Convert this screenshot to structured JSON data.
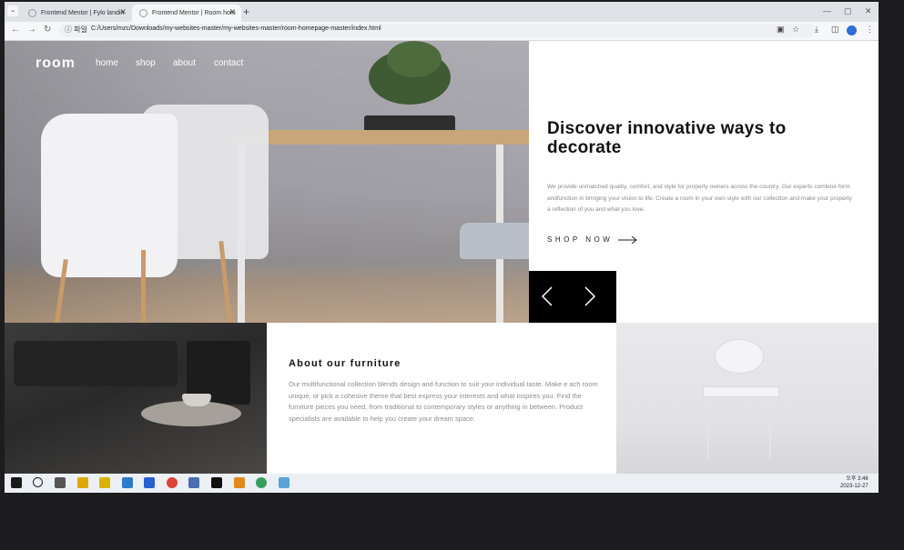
{
  "browser": {
    "tabs": [
      {
        "title": "Frontend Mentor | Fylo landin",
        "close": "✕"
      },
      {
        "title": "Frontend Mentor | Room hom",
        "close": "✕"
      }
    ],
    "new_tab": "+",
    "tab_list": "⌄",
    "window_controls": [
      "—",
      "▢",
      "✕"
    ],
    "site_info_label": "ⓘ 파일",
    "url": "C:/Users/mzc/Downloads/my-websites-master/my-websites-master/room-homepage-master/index.html",
    "icons": [
      "back-icon",
      "forward-icon",
      "reload-icon",
      "translate-icon",
      "star-icon",
      "download-icon",
      "sidepanel-icon",
      "profile-icon",
      "menu-icon"
    ]
  },
  "site": {
    "logo": "room",
    "nav": [
      "home",
      "shop",
      "about",
      "contact"
    ],
    "hero": {
      "title": "Discover innovative ways to decorate",
      "body": "We provide unmatched quality, comfort, and style for property owners across the country. Our experts combine form andfunction in bringing your vision to life. Create a room in your own style with our collection and make your property a reflection of you and what you love.",
      "cta": "SHOP NOW"
    },
    "slider": {
      "prev": "prev-icon",
      "next": "next-icon"
    },
    "about": {
      "title": "About our furniture",
      "body": "Our multifunctional collection blends design and function to suit your individual taste. Make e ach room unique, or pick a cohesive theme that best express your interests and what inspires you. Find the furniture pieces you need, from traditional to contemporary styles or anything in between. Product specialists are available to help you create your dream space."
    }
  },
  "taskbar": {
    "apps": [
      "windows-start-icon",
      "search-icon",
      "task-view-icon",
      "file-explorer-icon",
      "calendar-app-icon",
      "mail-icon",
      "zoom-icon",
      "chrome-icon",
      "3d-app-icon",
      "terminal-icon",
      "paint-icon",
      "chrome-alt-icon",
      "notepad-icon"
    ],
    "time": "오후 3:46",
    "date": "2023-12-27"
  },
  "colors": {
    "accent_dark": "#000000",
    "hero_title": "#111111",
    "body_gray": "#8a8a8a"
  }
}
